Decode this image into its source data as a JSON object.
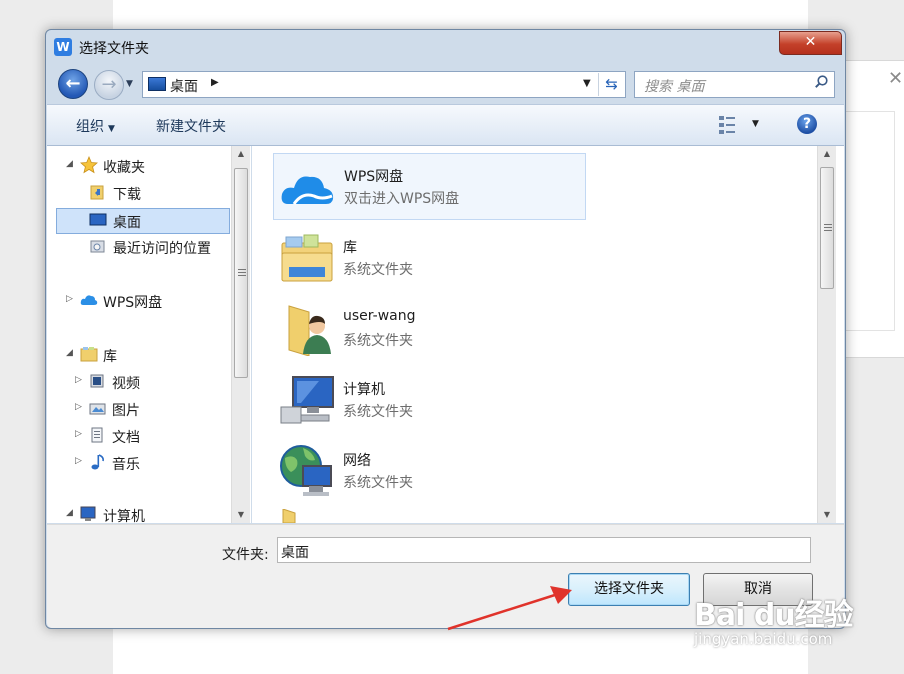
{
  "window": {
    "title": "选择文件夹",
    "app_icon_letter": "W",
    "close_symbol": "✕"
  },
  "nav": {
    "address_path": "桌面",
    "search_placeholder": "搜索 桌面"
  },
  "toolbar": {
    "organize_label": "组织",
    "new_folder_label": "新建文件夹",
    "help_symbol": "?"
  },
  "tree": {
    "favorites": "收藏夹",
    "downloads": "下载",
    "desktop": "桌面",
    "recent": "最近访问的位置",
    "wps_drive": "WPS网盘",
    "libraries": "库",
    "videos": "视频",
    "pictures": "图片",
    "documents": "文档",
    "music": "音乐",
    "computer": "计算机"
  },
  "content": {
    "items": [
      {
        "name": "WPS网盘",
        "type": "双击进入WPS网盘"
      },
      {
        "name": "库",
        "type": "系统文件夹"
      },
      {
        "name": "user-wang",
        "type": "系统文件夹"
      },
      {
        "name": "计算机",
        "type": "系统文件夹"
      },
      {
        "name": "网络",
        "type": "系统文件夹"
      }
    ]
  },
  "footer": {
    "folder_label": "文件夹:",
    "folder_value": "桌面",
    "select_button": "选择文件夹",
    "cancel_button": "取消"
  },
  "watermark": {
    "main": "Bai du经验",
    "sub": "jingyan.baidu.com"
  },
  "colors": {
    "accent": "#2f7de1",
    "selection": "#cfe3fa",
    "close": "#c4412a",
    "annotation_arrow": "#e0332b"
  }
}
